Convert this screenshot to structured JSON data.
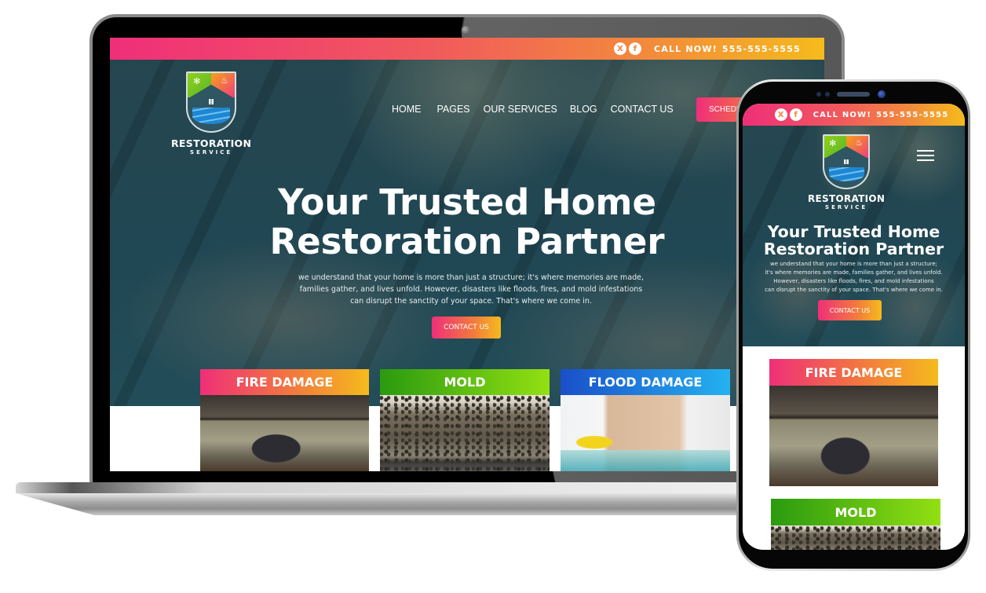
{
  "site": {
    "topbar": {
      "social": [
        {
          "icon": "x-twitter-icon",
          "glyph": "X"
        },
        {
          "icon": "facebook-icon",
          "glyph": "f"
        }
      ],
      "call_label": "CALL NOW!",
      "phone": "555-555-5555"
    },
    "logo": {
      "title": "RESTORATION",
      "subtitle": "SERVICE"
    },
    "nav": {
      "items": [
        "HOME",
        "PAGES",
        "OUR SERVICES",
        "BLOG",
        "CONTACT US"
      ],
      "schedule_label": "SCHEDU"
    },
    "hero": {
      "title_line1": "Your Trusted Home",
      "title_line2": "Restoration Partner",
      "body_desktop_lines": [
        "we understand that your home is more than just a structure; it's where memories are made,",
        "families gather, and lives unfold. However, disasters like floods, fires, and mold infestations",
        "can disrupt the sanctity of your space. That's where we come in."
      ],
      "body_mobile_lines": [
        "we understand that your home is more than just a structure;",
        "it's where memories are made, families gather, and lives unfold.",
        "However, disasters like floods, fires, and mold infestations",
        "can disrupt the sanctity of your space. That's where we come in."
      ],
      "cta_label": "CONTACT US"
    },
    "services": [
      {
        "label": "FIRE DAMAGE",
        "image": "burnt-kitchen"
      },
      {
        "label": "MOLD",
        "image": "mold-wall"
      },
      {
        "label": "FLOOD DAMAGE",
        "image": "flooded-kitchen"
      }
    ]
  },
  "colors": {
    "gradient_start": "#ef2f79",
    "gradient_mid": "#f2793e",
    "gradient_end": "#f5bb1c",
    "mold_start": "#2a9a0f",
    "mold_end": "#93e012",
    "flood_start": "#1a4fc9",
    "flood_end": "#24b2f0",
    "hero_overlay": "#27535f"
  }
}
